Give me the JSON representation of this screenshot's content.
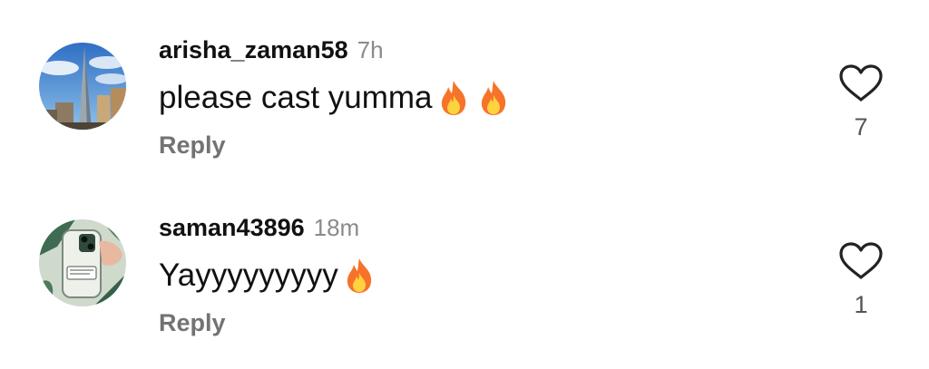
{
  "comments": [
    {
      "username": "arisha_zaman58",
      "time": "7h",
      "text": "please cast yumma",
      "emoji_count": 2,
      "reply_label": "Reply",
      "likes": "7",
      "avatar": "city-skyline-photo"
    },
    {
      "username": "saman43896",
      "time": "18m",
      "text": "Yayyyyyyyyy",
      "emoji_count": 1,
      "reply_label": "Reply",
      "likes": "1",
      "avatar": "phone-case-photo"
    }
  ],
  "icons": {
    "like": "heart-outline-icon",
    "emoji": "fire-emoji"
  },
  "colors": {
    "text": "#111111",
    "muted": "#8a8a8a",
    "reply": "#737373",
    "fire_outer": "#f7732a",
    "fire_inner": "#ffd23f"
  }
}
